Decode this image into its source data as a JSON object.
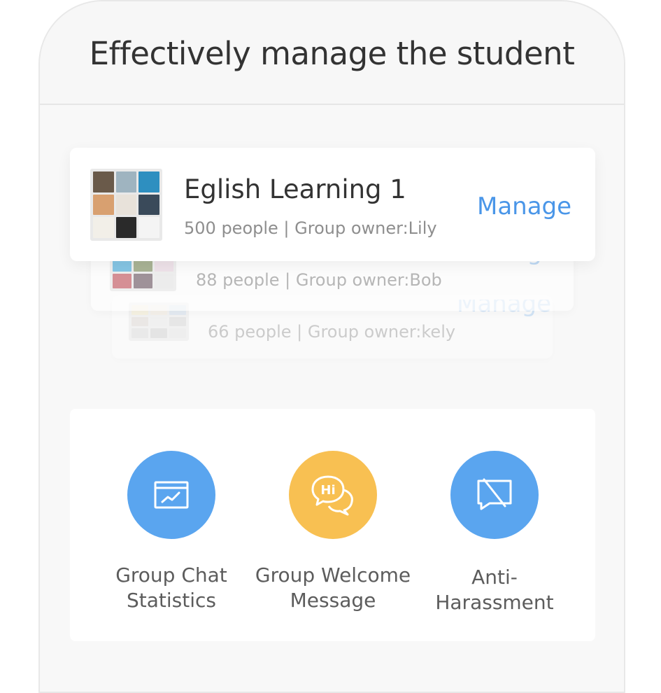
{
  "header": {
    "title": "Effectively manage the student"
  },
  "groups": [
    {
      "name": "Eglish Learning 1",
      "meta": "500 people | Group owner:Lily",
      "action": "Manage"
    },
    {
      "meta": "88 people | Group owner:Bob",
      "action": "Manage"
    },
    {
      "meta": "66 people | Group owner:kely",
      "action": "Manage"
    }
  ],
  "features": [
    {
      "label_line1": "Group Chat",
      "label_line2": "Statistics",
      "icon": "chart-window-icon",
      "color": "#5aa5ef"
    },
    {
      "label_line1": "Group Welcome",
      "label_line2": "Message",
      "icon": "hi-chat-bubbles-icon",
      "color": "#f8c052"
    },
    {
      "label_line1": "Anti-",
      "label_line2": "Harassment",
      "icon": "blocked-chat-icon",
      "color": "#5aa5ef"
    }
  ],
  "colors": {
    "accent": "#4a96e8",
    "blue_circle": "#5aa5ef",
    "yellow_circle": "#f8c052"
  }
}
